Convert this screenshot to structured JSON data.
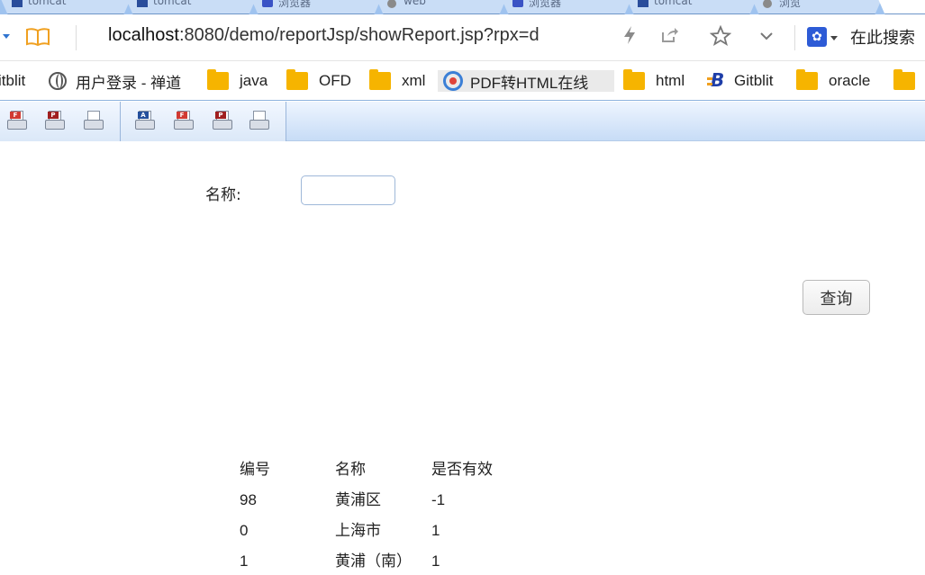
{
  "browser": {
    "tabs": [
      {
        "favicon": "college-icon",
        "title": "tomcat"
      },
      {
        "favicon": "college-icon",
        "title": "tomcat"
      },
      {
        "favicon": "cn-blog-icon",
        "title": "浏览器"
      },
      {
        "favicon": "globe-icon",
        "title": "web"
      },
      {
        "favicon": "cn-blog-icon",
        "title": "浏览器"
      },
      {
        "favicon": "college-icon",
        "title": "tomcat"
      },
      {
        "favicon": "globe-icon",
        "title": "浏览"
      }
    ],
    "address": {
      "host": "localhost",
      "rest": ":8080/demo/reportJsp/showReport.jsp?rpx=d"
    },
    "search_label": "在此搜索",
    "bookmarks": [
      {
        "label": "itblit",
        "icon": "none"
      },
      {
        "label": "用户登录 - 禅道",
        "icon": "globe-icon"
      },
      {
        "label": "java",
        "icon": "folder-icon"
      },
      {
        "label": "OFD",
        "icon": "folder-icon"
      },
      {
        "label": "xml",
        "icon": "folder-icon"
      },
      {
        "label": "PDF转HTML在线",
        "icon": "pdf-tool-icon"
      },
      {
        "label": "html",
        "icon": "folder-icon"
      },
      {
        "label": "Gitblit",
        "icon": "gitblit-icon"
      },
      {
        "label": "oracle",
        "icon": "folder-icon"
      }
    ]
  },
  "report_toolbar": {
    "buttons": [
      {
        "name": "print-flash-button",
        "badge": "F"
      },
      {
        "name": "print-pdf-button",
        "badge": "P"
      },
      {
        "name": "print-button",
        "badge": ""
      },
      {
        "name": "export-excel-button",
        "badge": "A"
      },
      {
        "name": "export-flash-button",
        "badge": "F"
      },
      {
        "name": "export-pdf-button",
        "badge": "P"
      },
      {
        "name": "export-print-button",
        "badge": ""
      }
    ]
  },
  "form": {
    "name_label": "名称:",
    "name_value": "",
    "query_label": "查询"
  },
  "table": {
    "headers": [
      "编号",
      "名称",
      "是否有效"
    ],
    "rows": [
      [
        "98",
        "黄浦区",
        "-1"
      ],
      [
        "0",
        "上海市",
        "1"
      ],
      [
        "1",
        "黄浦（南）",
        "1"
      ]
    ]
  },
  "colors": {
    "tabstrip": "#9fc3ef",
    "accent": "#2f74d0",
    "folder": "#f6b400",
    "toolbar": "#c7dcf6"
  }
}
